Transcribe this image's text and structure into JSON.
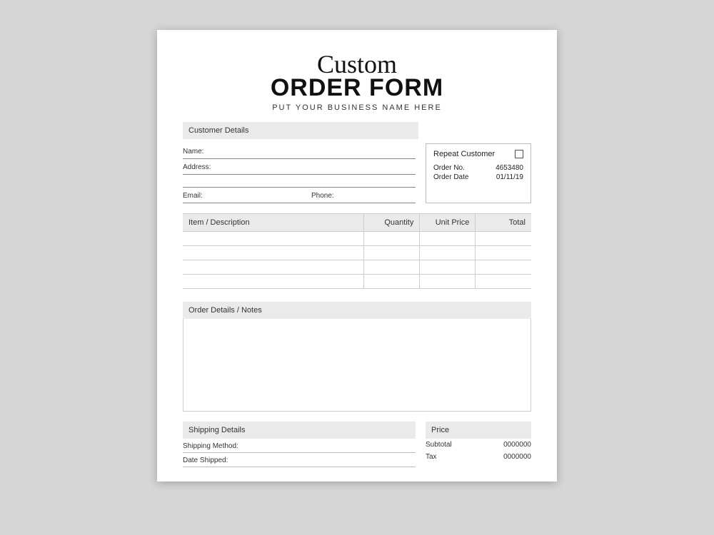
{
  "header": {
    "script": "Custom",
    "title": "ORDER FORM",
    "subtitle": "PUT YOUR BUSINESS NAME HERE"
  },
  "customer": {
    "section": "Customer Details",
    "name_label": "Name:",
    "address_label": "Address:",
    "email_label": "Email:",
    "phone_label": "Phone:"
  },
  "order_meta": {
    "repeat_label": "Repeat Customer",
    "order_no_label": "Order No.",
    "order_no": "4653480",
    "order_date_label": "Order Date",
    "order_date": "01/11/19"
  },
  "items": {
    "h_desc": "Item / Description",
    "h_qty": "Quantity",
    "h_unit": "Unit Price",
    "h_total": "Total"
  },
  "notes": {
    "section": "Order Details / Notes"
  },
  "shipping": {
    "section": "Shipping Details",
    "method_label": "Shipping Method:",
    "date_label": "Date Shipped:"
  },
  "price": {
    "section": "Price",
    "subtotal_label": "Subtotal",
    "subtotal": "0000000",
    "tax_label": "Tax",
    "tax": "0000000"
  }
}
